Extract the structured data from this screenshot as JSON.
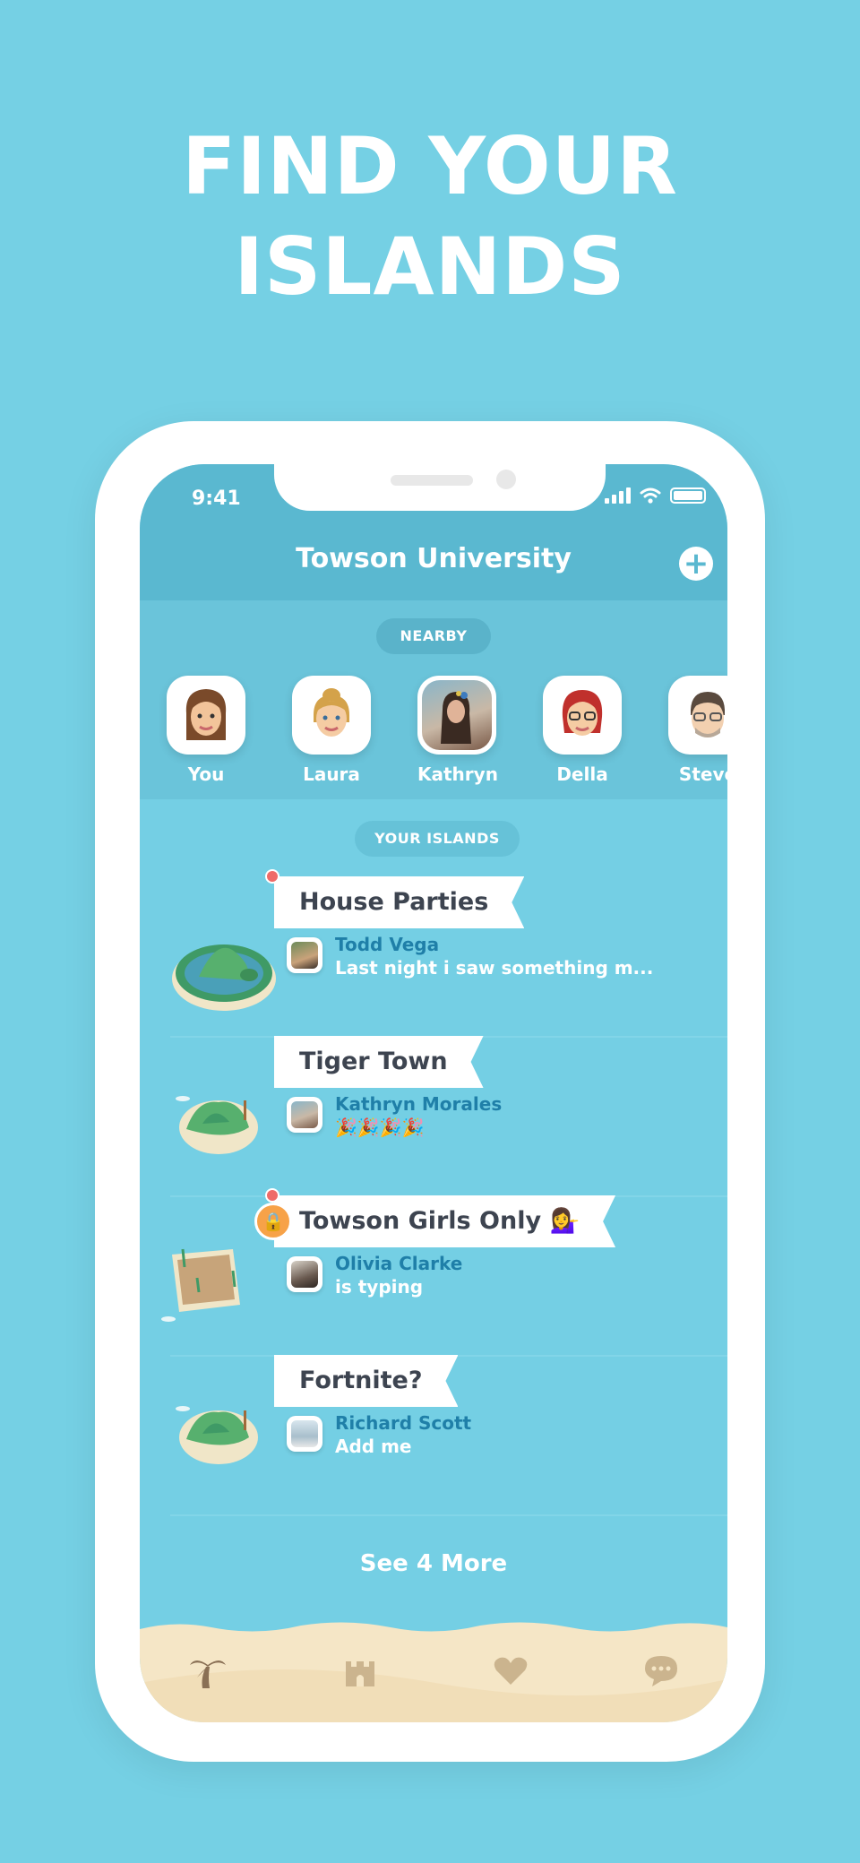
{
  "headline": {
    "line1": "FIND YOUR",
    "line2": "ISLANDS"
  },
  "status_bar": {
    "time": "9:41"
  },
  "header": {
    "title": "Towson University",
    "add_icon": "plus-circle-icon"
  },
  "nearby": {
    "label": "NEARBY",
    "people": [
      {
        "name": "You"
      },
      {
        "name": "Laura"
      },
      {
        "name": "Kathryn"
      },
      {
        "name": "Della"
      },
      {
        "name": "Steve"
      }
    ]
  },
  "islands": {
    "label": "YOUR ISLANDS",
    "items": [
      {
        "name": "House Parties",
        "author": "Todd Vega",
        "message": "Last night i saw something m...",
        "unread": true,
        "locked": false
      },
      {
        "name": "Tiger Town",
        "author": "Kathryn Morales",
        "message": "🎉🎉🎉🎉",
        "unread": false,
        "locked": false
      },
      {
        "name": "Towson Girls Only 💁‍♀️",
        "author": "Olivia Clarke",
        "message": "is typing",
        "unread": true,
        "locked": true
      },
      {
        "name": "Fortnite?",
        "author": "Richard Scott",
        "message": "Add me",
        "unread": false,
        "locked": false
      }
    ],
    "see_more": "See 4 More"
  },
  "tabs": [
    {
      "icon": "palm-tree-icon",
      "active": true
    },
    {
      "icon": "castle-icon",
      "active": false
    },
    {
      "icon": "heart-icon",
      "active": false
    },
    {
      "icon": "chat-bubble-icon",
      "active": false
    }
  ],
  "colors": {
    "background": "#75d0e4",
    "header": "#5ab8d0",
    "author_name": "#1f7fa8",
    "unread_dot": "#ef6b68",
    "lock_badge": "#f7a248",
    "sand": "#f5e6c6"
  }
}
